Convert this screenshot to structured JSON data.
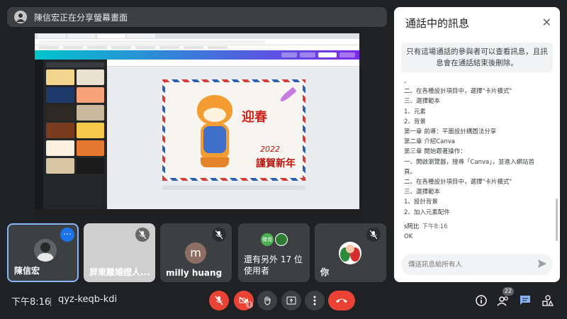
{
  "banner": {
    "text": "陳信宏正在分享螢幕畫面"
  },
  "shared_screen": {
    "card_text_top": "迎春",
    "card_text_year": "2022",
    "card_text_greeting": "謹賀新年"
  },
  "participants": [
    {
      "name": "陳信宏"
    },
    {
      "name": "屏東離婚證人..."
    },
    {
      "name": "milly huang",
      "initial": "m"
    },
    {
      "name": "還有另外 17 位使用者",
      "mini1": "傑克",
      "mini2": ""
    },
    {
      "name": "你"
    }
  ],
  "chat": {
    "title": "通話中的訊息",
    "notice": "只有這場通話的參與者可以查看訊息，且訊息會在通話結束後刪除。",
    "lines": [
      "、",
      "二、在各種設計項目中，選擇\"卡片橫式\"",
      "三、選擇範本",
      "1、元素",
      "2、背景",
      "",
      "第一章 前導：平面設計構圖法分享",
      "第二章 介紹Canva",
      "第三章 開始跟著操作：",
      "一、開啟瀏覽器，搜尋「Canva」，並進入網站首",
      "頁。",
      "二、在各種設計項目中，選擇\"卡片橫式\"",
      "三、選擇範本",
      "1、設計背景",
      "2、加入元素配件"
    ],
    "sender": "s阿比",
    "sender_time": "下午8:16",
    "last_message": "OK",
    "input_placeholder": "傳送訊息給所有人"
  },
  "bottom_bar": {
    "time": "下午8:16",
    "meeting_code": "qyz-keqb-kdi",
    "participant_count": "22",
    "alert": "!"
  },
  "colors": {
    "accent": "#1a73e8",
    "danger": "#ea4335",
    "background": "#202124"
  }
}
